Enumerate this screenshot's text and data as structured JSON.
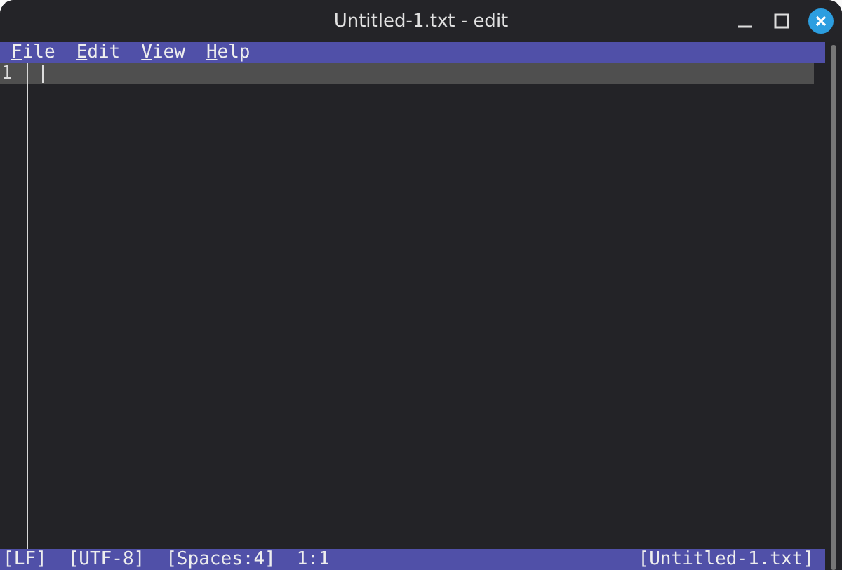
{
  "window": {
    "title": "Untitled-1.txt - edit"
  },
  "menu": [
    "File",
    "Edit",
    "View",
    "Help"
  ],
  "editor": {
    "line_numbers": [
      "1"
    ]
  },
  "status_bar": {
    "left": [
      "[LF]",
      "[UTF-8]",
      "[Spaces:4]",
      "1:1"
    ],
    "right": "[Untitled-1.txt]"
  }
}
